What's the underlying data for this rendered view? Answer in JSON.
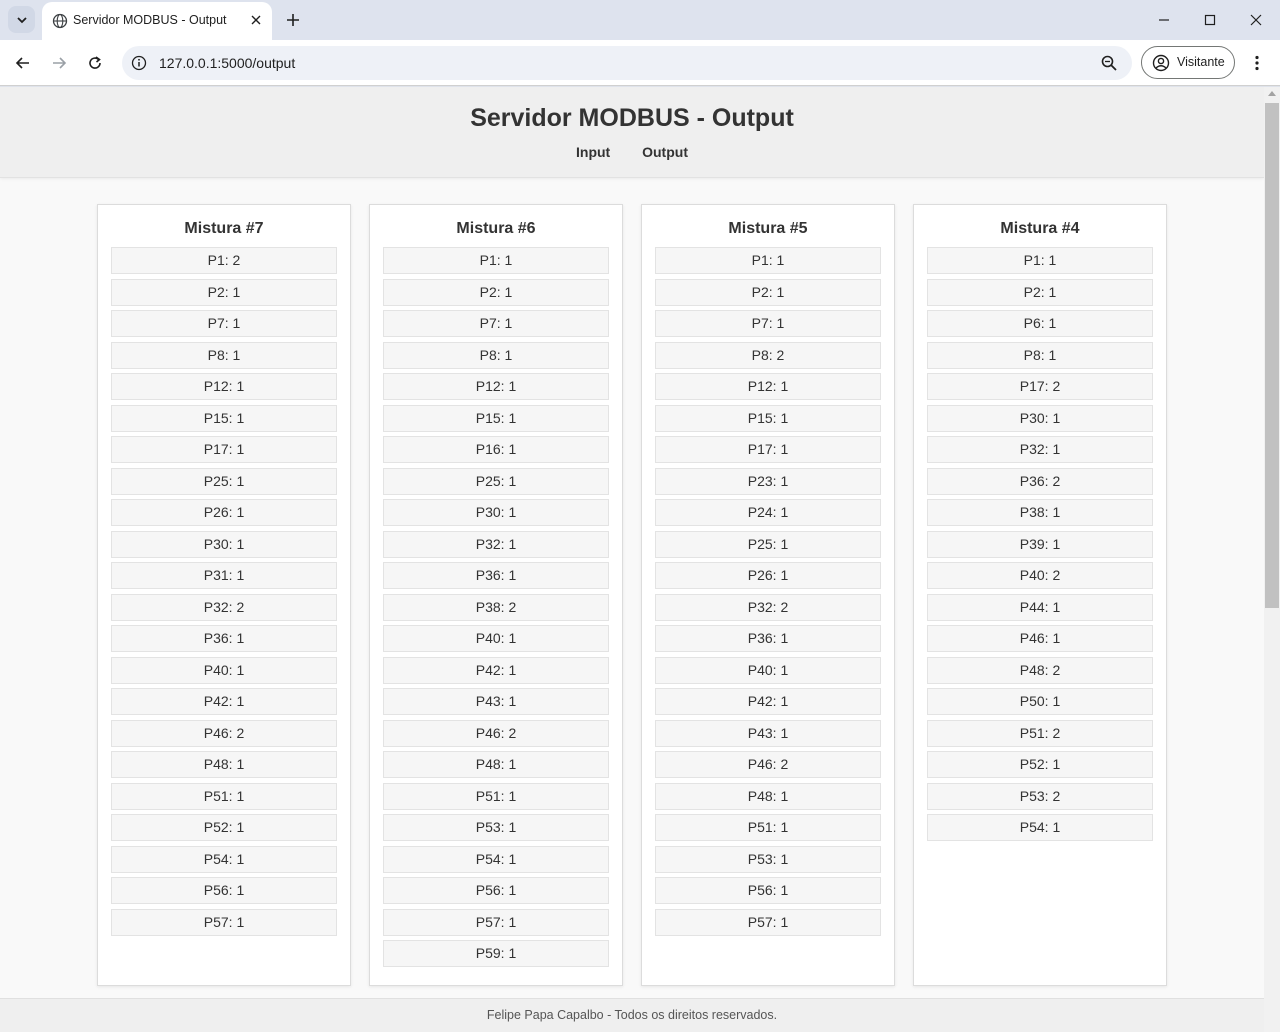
{
  "browser": {
    "tab_title": "Servidor MODBUS - Output",
    "url": "127.0.0.1:5000/output",
    "profile_label": "Visitante"
  },
  "page": {
    "title": "Servidor MODBUS - Output",
    "nav": [
      "Input",
      "Output"
    ],
    "footer": "Felipe Papa Capalbo - Todos os direitos reservados."
  },
  "misturas": [
    {
      "title": "Mistura #7",
      "items": [
        "P1: 2",
        "P2: 1",
        "P7: 1",
        "P8: 1",
        "P12: 1",
        "P15: 1",
        "P17: 1",
        "P25: 1",
        "P26: 1",
        "P30: 1",
        "P31: 1",
        "P32: 2",
        "P36: 1",
        "P40: 1",
        "P42: 1",
        "P46: 2",
        "P48: 1",
        "P51: 1",
        "P52: 1",
        "P54: 1",
        "P56: 1",
        "P57: 1"
      ]
    },
    {
      "title": "Mistura #6",
      "items": [
        "P1: 1",
        "P2: 1",
        "P7: 1",
        "P8: 1",
        "P12: 1",
        "P15: 1",
        "P16: 1",
        "P25: 1",
        "P30: 1",
        "P32: 1",
        "P36: 1",
        "P38: 2",
        "P40: 1",
        "P42: 1",
        "P43: 1",
        "P46: 2",
        "P48: 1",
        "P51: 1",
        "P53: 1",
        "P54: 1",
        "P56: 1",
        "P57: 1",
        "P59: 1"
      ]
    },
    {
      "title": "Mistura #5",
      "items": [
        "P1: 1",
        "P2: 1",
        "P7: 1",
        "P8: 2",
        "P12: 1",
        "P15: 1",
        "P17: 1",
        "P23: 1",
        "P24: 1",
        "P25: 1",
        "P26: 1",
        "P32: 2",
        "P36: 1",
        "P40: 1",
        "P42: 1",
        "P43: 1",
        "P46: 2",
        "P48: 1",
        "P51: 1",
        "P53: 1",
        "P56: 1",
        "P57: 1"
      ]
    },
    {
      "title": "Mistura #4",
      "items": [
        "P1: 1",
        "P2: 1",
        "P6: 1",
        "P8: 1",
        "P17: 2",
        "P30: 1",
        "P32: 1",
        "P36: 2",
        "P38: 1",
        "P39: 1",
        "P40: 2",
        "P44: 1",
        "P46: 1",
        "P48: 2",
        "P50: 1",
        "P51: 2",
        "P52: 1",
        "P53: 2",
        "P54: 1"
      ]
    }
  ]
}
